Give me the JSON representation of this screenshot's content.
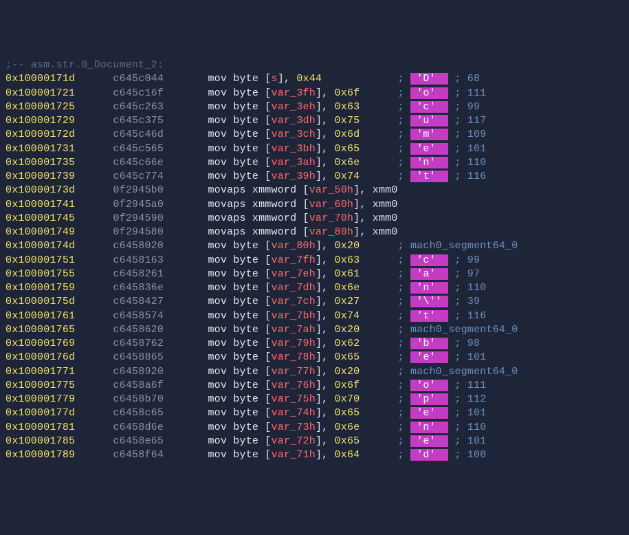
{
  "label": ";-- asm.str.0_Document_2:",
  "rows": [
    {
      "addr": "0x10000171d",
      "hex": "c645c044",
      "asm": {
        "op": "mov byte",
        "arg": "[",
        "var": "s",
        "suffix": "], ",
        "imm": "0x44"
      },
      "cmt": {
        "type": "char",
        "ch": "'D'",
        "dec": "68"
      }
    },
    {
      "addr": "0x100001721",
      "hex": "c645c16f",
      "asm": {
        "op": "mov byte",
        "arg": "[",
        "var": "var_3fh",
        "suffix": "], ",
        "imm": "0x6f"
      },
      "cmt": {
        "type": "char",
        "ch": "'o'",
        "dec": "111"
      }
    },
    {
      "addr": "0x100001725",
      "hex": "c645c263",
      "asm": {
        "op": "mov byte",
        "arg": "[",
        "var": "var_3eh",
        "suffix": "], ",
        "imm": "0x63"
      },
      "cmt": {
        "type": "char",
        "ch": "'c'",
        "dec": "99"
      }
    },
    {
      "addr": "0x100001729",
      "hex": "c645c375",
      "asm": {
        "op": "mov byte",
        "arg": "[",
        "var": "var_3dh",
        "suffix": "], ",
        "imm": "0x75"
      },
      "cmt": {
        "type": "char",
        "ch": "'u'",
        "dec": "117"
      }
    },
    {
      "addr": "0x10000172d",
      "hex": "c645c46d",
      "asm": {
        "op": "mov byte",
        "arg": "[",
        "var": "var_3ch",
        "suffix": "], ",
        "imm": "0x6d"
      },
      "cmt": {
        "type": "char",
        "ch": "'m'",
        "dec": "109"
      }
    },
    {
      "addr": "0x100001731",
      "hex": "c645c565",
      "asm": {
        "op": "mov byte",
        "arg": "[",
        "var": "var_3bh",
        "suffix": "], ",
        "imm": "0x65"
      },
      "cmt": {
        "type": "char",
        "ch": "'e'",
        "dec": "101"
      }
    },
    {
      "addr": "0x100001735",
      "hex": "c645c66e",
      "asm": {
        "op": "mov byte",
        "arg": "[",
        "var": "var_3ah",
        "suffix": "], ",
        "imm": "0x6e"
      },
      "cmt": {
        "type": "char",
        "ch": "'n'",
        "dec": "110"
      }
    },
    {
      "addr": "0x100001739",
      "hex": "c645c774",
      "asm": {
        "op": "mov byte",
        "arg": "[",
        "var": "var_39h",
        "suffix": "], ",
        "imm": "0x74"
      },
      "cmt": {
        "type": "char",
        "ch": "'t'",
        "dec": "116"
      }
    },
    {
      "addr": "0x10000173d",
      "hex": "0f2945b0",
      "asm": {
        "op": "movaps xmmword",
        "arg": "[",
        "var": "var_50h",
        "suffix": "], ",
        "reg": "xmm0"
      }
    },
    {
      "addr": "0x100001741",
      "hex": "0f2945a0",
      "asm": {
        "op": "movaps xmmword",
        "arg": "[",
        "var": "var_60h",
        "suffix": "], ",
        "reg": "xmm0"
      }
    },
    {
      "addr": "0x100001745",
      "hex": "0f294590",
      "asm": {
        "op": "movaps xmmword",
        "arg": "[",
        "var": "var_70h",
        "suffix": "], ",
        "reg": "xmm0"
      }
    },
    {
      "addr": "0x100001749",
      "hex": "0f294580",
      "asm": {
        "op": "movaps xmmword",
        "arg": "[",
        "var": "var_80h",
        "suffix": "], ",
        "reg": "xmm0"
      }
    },
    {
      "addr": "0x10000174d",
      "hex": "c6458020",
      "asm": {
        "op": "mov byte",
        "arg": "[",
        "var": "var_80h",
        "suffix": "], ",
        "imm": "0x20"
      },
      "cmt": {
        "type": "seg",
        "text": "mach0_segment64_0"
      }
    },
    {
      "addr": "0x100001751",
      "hex": "c6458163",
      "asm": {
        "op": "mov byte",
        "arg": "[",
        "var": "var_7fh",
        "suffix": "], ",
        "imm": "0x63"
      },
      "cmt": {
        "type": "char",
        "ch": "'c'",
        "dec": "99"
      }
    },
    {
      "addr": "0x100001755",
      "hex": "c6458261",
      "asm": {
        "op": "mov byte",
        "arg": "[",
        "var": "var_7eh",
        "suffix": "], ",
        "imm": "0x61"
      },
      "cmt": {
        "type": "char",
        "ch": "'a'",
        "dec": "97"
      }
    },
    {
      "addr": "0x100001759",
      "hex": "c645836e",
      "asm": {
        "op": "mov byte",
        "arg": "[",
        "var": "var_7dh",
        "suffix": "], ",
        "imm": "0x6e"
      },
      "cmt": {
        "type": "char",
        "ch": "'n'",
        "dec": "110"
      }
    },
    {
      "addr": "0x10000175d",
      "hex": "c6458427",
      "asm": {
        "op": "mov byte",
        "arg": "[",
        "var": "var_7ch",
        "suffix": "], ",
        "imm": "0x27"
      },
      "cmt": {
        "type": "char",
        "ch": "'\\''",
        "dec": "39"
      }
    },
    {
      "addr": "0x100001761",
      "hex": "c6458574",
      "asm": {
        "op": "mov byte",
        "arg": "[",
        "var": "var_7bh",
        "suffix": "], ",
        "imm": "0x74"
      },
      "cmt": {
        "type": "char",
        "ch": "'t'",
        "dec": "116"
      }
    },
    {
      "addr": "0x100001765",
      "hex": "c6458620",
      "asm": {
        "op": "mov byte",
        "arg": "[",
        "var": "var_7ah",
        "suffix": "], ",
        "imm": "0x20"
      },
      "cmt": {
        "type": "seg",
        "text": "mach0_segment64_0"
      }
    },
    {
      "addr": "0x100001769",
      "hex": "c6458762",
      "asm": {
        "op": "mov byte",
        "arg": "[",
        "var": "var_79h",
        "suffix": "], ",
        "imm": "0x62"
      },
      "cmt": {
        "type": "char",
        "ch": "'b'",
        "dec": "98"
      }
    },
    {
      "addr": "0x10000176d",
      "hex": "c6458865",
      "asm": {
        "op": "mov byte",
        "arg": "[",
        "var": "var_78h",
        "suffix": "], ",
        "imm": "0x65"
      },
      "cmt": {
        "type": "char",
        "ch": "'e'",
        "dec": "101"
      }
    },
    {
      "addr": "0x100001771",
      "hex": "c6458920",
      "asm": {
        "op": "mov byte",
        "arg": "[",
        "var": "var_77h",
        "suffix": "], ",
        "imm": "0x20"
      },
      "cmt": {
        "type": "seg",
        "text": "mach0_segment64_0"
      }
    },
    {
      "addr": "0x100001775",
      "hex": "c6458a6f",
      "asm": {
        "op": "mov byte",
        "arg": "[",
        "var": "var_76h",
        "suffix": "], ",
        "imm": "0x6f"
      },
      "cmt": {
        "type": "char",
        "ch": "'o'",
        "dec": "111"
      }
    },
    {
      "addr": "0x100001779",
      "hex": "c6458b70",
      "asm": {
        "op": "mov byte",
        "arg": "[",
        "var": "var_75h",
        "suffix": "], ",
        "imm": "0x70"
      },
      "cmt": {
        "type": "char",
        "ch": "'p'",
        "dec": "112"
      }
    },
    {
      "addr": "0x10000177d",
      "hex": "c6458c65",
      "asm": {
        "op": "mov byte",
        "arg": "[",
        "var": "var_74h",
        "suffix": "], ",
        "imm": "0x65"
      },
      "cmt": {
        "type": "char",
        "ch": "'e'",
        "dec": "101"
      }
    },
    {
      "addr": "0x100001781",
      "hex": "c6458d6e",
      "asm": {
        "op": "mov byte",
        "arg": "[",
        "var": "var_73h",
        "suffix": "], ",
        "imm": "0x6e"
      },
      "cmt": {
        "type": "char",
        "ch": "'n'",
        "dec": "110"
      }
    },
    {
      "addr": "0x100001785",
      "hex": "c6458e65",
      "asm": {
        "op": "mov byte",
        "arg": "[",
        "var": "var_72h",
        "suffix": "], ",
        "imm": "0x65"
      },
      "cmt": {
        "type": "char",
        "ch": "'e'",
        "dec": "101"
      }
    },
    {
      "addr": "0x100001789",
      "hex": "c6458f64",
      "asm": {
        "op": "mov byte",
        "arg": "[",
        "var": "var_71h",
        "suffix": "], ",
        "imm": "0x64"
      },
      "cmt": {
        "type": "char",
        "ch": "'d'",
        "dec": "100"
      }
    }
  ]
}
